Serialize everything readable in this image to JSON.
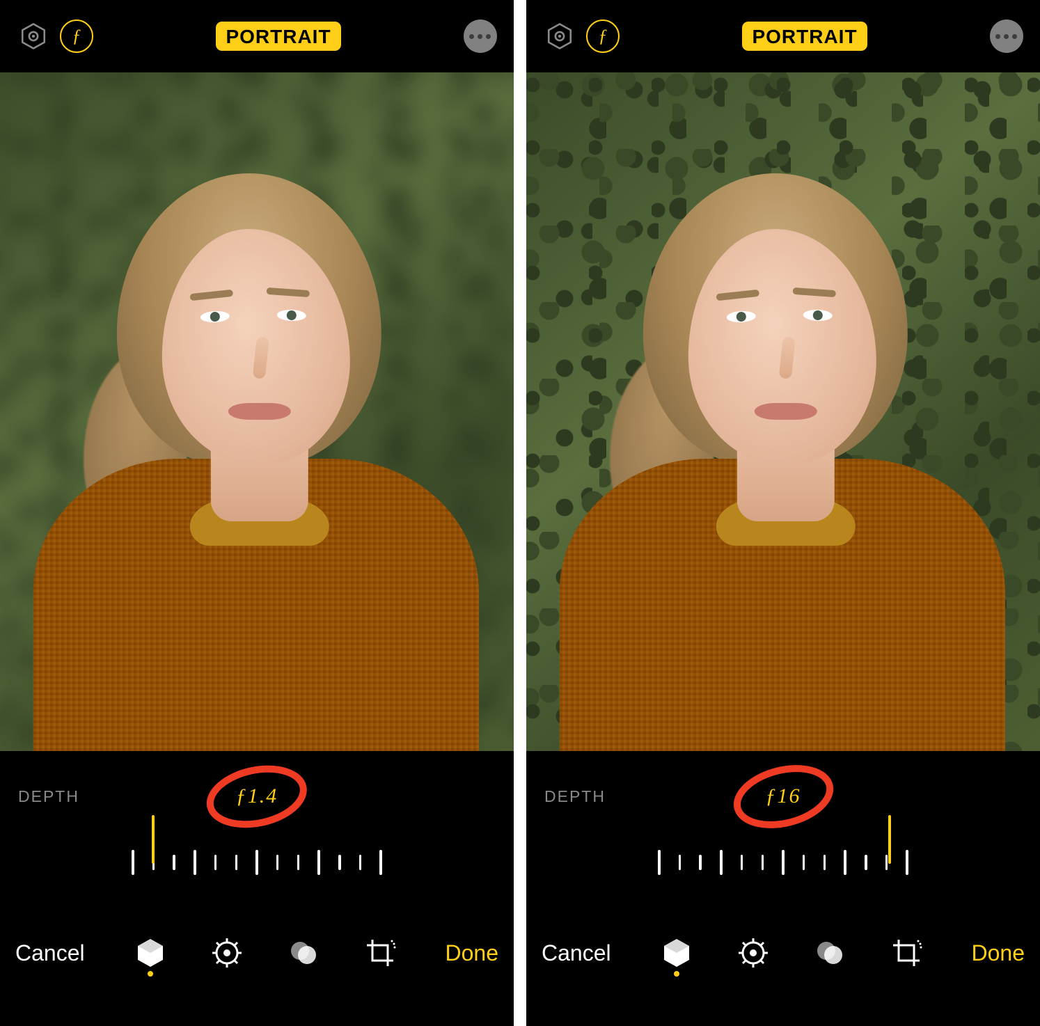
{
  "panes": [
    {
      "mode_label": "PORTRAIT",
      "depth_label": "DEPTH",
      "depth_value": "ƒ1.4",
      "needle_position_pct": 8,
      "bg_blur": "blurry",
      "buttons": {
        "cancel": "Cancel",
        "done": "Done"
      }
    },
    {
      "mode_label": "PORTRAIT",
      "depth_label": "DEPTH",
      "depth_value": "ƒ16",
      "needle_position_pct": 92,
      "bg_blur": "sharp",
      "buttons": {
        "cancel": "Cancel",
        "done": "Done"
      }
    }
  ],
  "colors": {
    "accent": "#ffcf17",
    "annotation": "#ef3a24"
  }
}
